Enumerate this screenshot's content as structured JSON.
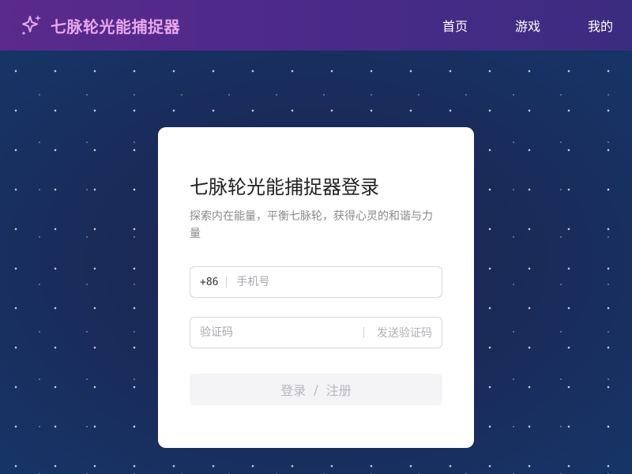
{
  "navbar": {
    "brand_title": "七脉轮光能捕捉器",
    "brand_icon": "sparkles-icon",
    "links": [
      {
        "label": "首页"
      },
      {
        "label": "游戏"
      },
      {
        "label": "我的"
      }
    ],
    "colors": {
      "start": "#5a2a8c",
      "end": "#3b2c80",
      "brand_text": "#e9a6ec"
    }
  },
  "login": {
    "title": "七脉轮光能捕捉器登录",
    "subtitle": "探索内在能量，平衡七脉轮，获得心灵的和谐与力量",
    "phone": {
      "prefix": "+86",
      "placeholder": "手机号",
      "value": ""
    },
    "code": {
      "placeholder": "验证码",
      "value": "",
      "send_label": "发送验证码"
    },
    "submit": {
      "login_label": "登录",
      "divider": "/",
      "register_label": "注册"
    }
  },
  "background": {
    "color": "#17305f",
    "pattern": "starfield"
  }
}
